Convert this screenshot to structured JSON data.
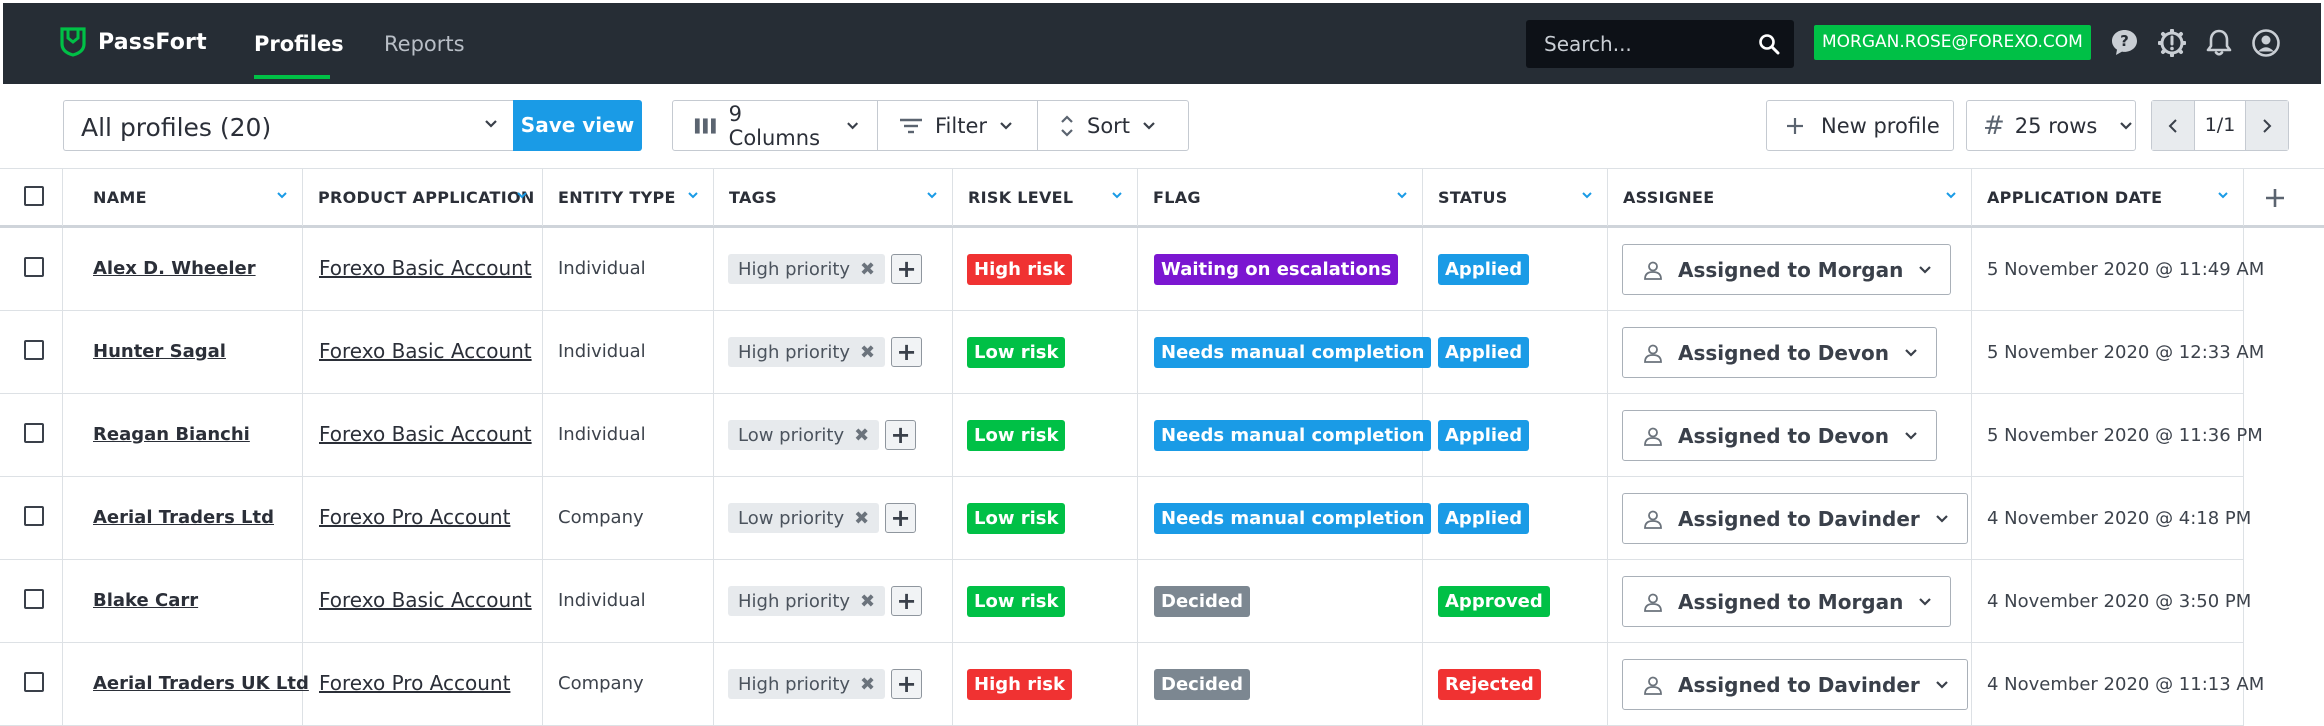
{
  "app": {
    "name": "PassFort"
  },
  "nav": {
    "items": [
      {
        "label": "Profiles",
        "active": true
      },
      {
        "label": "Reports",
        "active": false
      }
    ]
  },
  "search": {
    "placeholder": "Search...",
    "value": ""
  },
  "user": {
    "email": "MORGAN.ROSE@FOREXO.COM"
  },
  "toolbar": {
    "view_label": "All profiles (20)",
    "save_view_label": "Save view",
    "columns_label": "9 Columns",
    "filter_label": "Filter",
    "sort_label": "Sort",
    "new_profile_label": "New profile",
    "rows_label": "25 rows",
    "page_label": "1/1"
  },
  "table": {
    "columns": [
      "NAME",
      "PRODUCT APPLICATION",
      "ENTITY TYPE",
      "TAGS",
      "RISK LEVEL",
      "FLAG",
      "STATUS",
      "ASSIGNEE",
      "APPLICATION DATE"
    ],
    "rows": [
      {
        "name": "Alex D. Wheeler",
        "product": "Forexo Basic Account",
        "entity": "Individual",
        "tag": "High priority",
        "risk": "High risk",
        "risk_color": "#f03232",
        "flag": "Waiting on escalations",
        "flag_color": "#7b16d1",
        "status": "Applied",
        "status_color": "#1a9be6",
        "assignee": "Assigned to Morgan",
        "date": "5 November 2020 @ 11:49 AM"
      },
      {
        "name": "Hunter Sagal",
        "product": "Forexo Basic Account",
        "entity": "Individual",
        "tag": "High priority",
        "risk": "Low risk",
        "risk_color": "#00c046",
        "flag": "Needs manual completion",
        "flag_color": "#1a9be6",
        "status": "Applied",
        "status_color": "#1a9be6",
        "assignee": "Assigned to Devon",
        "date": "5 November 2020 @ 12:33 AM"
      },
      {
        "name": "Reagan Bianchi",
        "product": "Forexo Basic Account",
        "entity": "Individual",
        "tag": "Low priority",
        "risk": "Low risk",
        "risk_color": "#00c046",
        "flag": "Needs manual completion",
        "flag_color": "#1a9be6",
        "status": "Applied",
        "status_color": "#1a9be6",
        "assignee": "Assigned to Devon",
        "date": "5 November 2020 @ 11:36 PM"
      },
      {
        "name": "Aerial Traders Ltd",
        "product": "Forexo Pro Account",
        "entity": "Company",
        "tag": "Low priority",
        "risk": "Low risk",
        "risk_color": "#00c046",
        "flag": "Needs manual completion",
        "flag_color": "#1a9be6",
        "status": "Applied",
        "status_color": "#1a9be6",
        "assignee": "Assigned to Davinder",
        "date": "4 November 2020 @ 4:18 PM"
      },
      {
        "name": "Blake Carr",
        "product": "Forexo Basic Account",
        "entity": "Individual",
        "tag": "High priority",
        "risk": "Low risk",
        "risk_color": "#00c046",
        "flag": "Decided",
        "flag_color": "#7c8791",
        "status": "Approved",
        "status_color": "#00c046",
        "assignee": "Assigned to Morgan",
        "date": "4 November 2020 @ 3:50 PM"
      },
      {
        "name": "Aerial Traders UK Ltd",
        "product": "Forexo Pro Account",
        "entity": "Company",
        "tag": "High priority",
        "risk": "High risk",
        "risk_color": "#f03232",
        "flag": "Decided",
        "flag_color": "#7c8791",
        "status": "Rejected",
        "status_color": "#f03232",
        "assignee": "Assigned to Davinder",
        "date": "4 November 2020 @ 11:13 AM"
      }
    ]
  },
  "colors": {
    "topbar": "#262d35",
    "brand_green": "#00c046",
    "primary_blue": "#1a9be6",
    "danger_red": "#f03232",
    "purple": "#7b16d1",
    "neutral_grey": "#7c8791"
  },
  "icons": {
    "logo": "shield-logo-icon",
    "search": "search-icon",
    "help": "help-icon",
    "alert": "alert-gear-icon",
    "notifications": "bell-icon",
    "account": "user-circle-icon",
    "columns": "columns-icon",
    "filter": "filter-icon",
    "sort": "sort-icon",
    "add": "plus-icon",
    "assignee": "user-icon"
  }
}
